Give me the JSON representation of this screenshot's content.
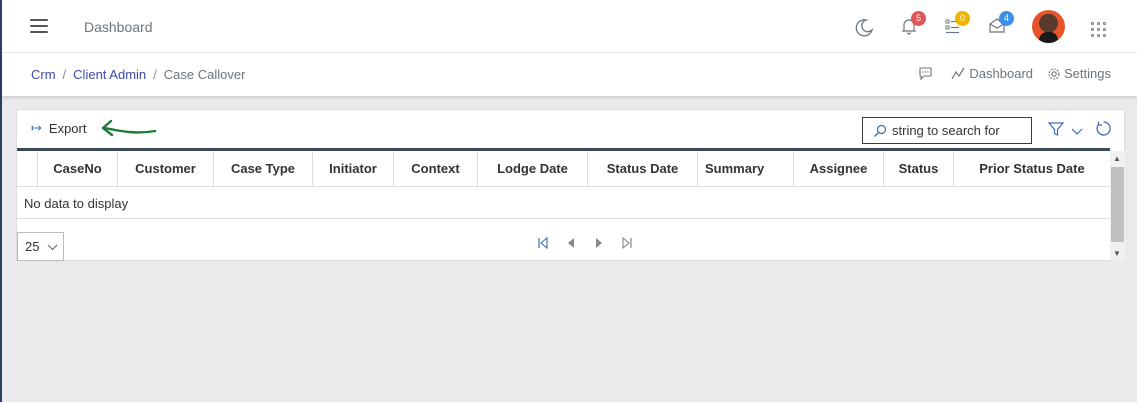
{
  "header": {
    "title": "Dashboard",
    "notifications_count": "5",
    "tasks_count": "0",
    "messages_count": "4",
    "colors": {
      "notifications": "#e05555",
      "tasks": "#f0b400",
      "messages": "#3a8fe6"
    }
  },
  "breadcrumb": {
    "items": [
      "Crm",
      "Client Admin"
    ],
    "current": "Case Callover"
  },
  "sub_actions": {
    "dashboard_label": "Dashboard",
    "settings_label": "Settings"
  },
  "toolbar": {
    "export_label": "Export",
    "search_placeholder": "string to search for"
  },
  "grid": {
    "columns": [
      "CaseNo",
      "Customer",
      "Case Type",
      "Initiator",
      "Context",
      "Lodge Date",
      "Status Date",
      "Summary",
      "Assignee",
      "Status",
      "Prior Status Date"
    ],
    "empty_text": "No data to display"
  },
  "pager": {
    "page_size": "25"
  },
  "icons": [
    "menu-icon",
    "moon-icon",
    "bell-icon",
    "tasks-icon",
    "envelope-icon",
    "apps-grid-icon",
    "chat-icon",
    "chart-line-icon",
    "gear-icon",
    "export-arrow-icon",
    "search-icon",
    "filter-icon",
    "chevron-down-icon",
    "refresh-icon",
    "first-page-icon",
    "prev-page-icon",
    "next-page-icon",
    "last-page-icon"
  ]
}
